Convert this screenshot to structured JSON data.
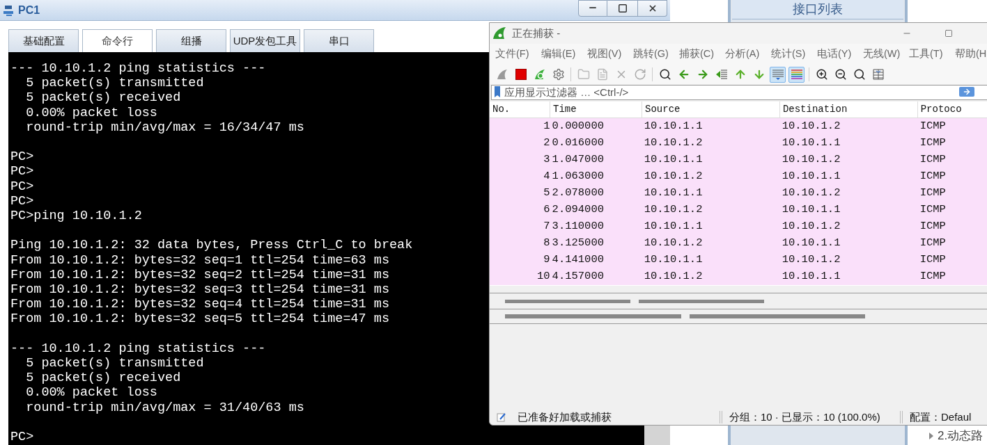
{
  "pc_window": {
    "title": "PC1",
    "tabs": [
      {
        "label": "基础配置",
        "selected": false
      },
      {
        "label": "命令行",
        "selected": true
      },
      {
        "label": "组播",
        "selected": false
      },
      {
        "label": "UDP发包工具",
        "selected": false
      },
      {
        "label": "串口",
        "selected": false
      }
    ],
    "terminal_blocks": [
      [
        "--- 10.10.1.2 ping statistics ---",
        "  5 packet(s) transmitted",
        "  5 packet(s) received",
        "  0.00% packet loss",
        "  round-trip min/avg/max = 16/34/47 ms"
      ],
      [
        "PC>",
        "PC>",
        "PC>",
        "PC>",
        "PC>ping 10.10.1.2"
      ],
      [
        "Ping 10.10.1.2: 32 data bytes, Press Ctrl_C to break",
        "From 10.10.1.2: bytes=32 seq=1 ttl=254 time=63 ms",
        "From 10.10.1.2: bytes=32 seq=2 ttl=254 time=31 ms",
        "From 10.10.1.2: bytes=32 seq=3 ttl=254 time=31 ms",
        "From 10.10.1.2: bytes=32 seq=4 ttl=254 time=31 ms",
        "From 10.10.1.2: bytes=32 seq=5 ttl=254 time=47 ms"
      ],
      [
        "--- 10.10.1.2 ping statistics ---",
        "  5 packet(s) transmitted",
        "  5 packet(s) received",
        "  0.00% packet loss",
        "  round-trip min/avg/max = 31/40/63 ms"
      ],
      [
        "PC>"
      ]
    ]
  },
  "background": {
    "interface_list_button": "接口列表",
    "tree_item": "2.动态路"
  },
  "capture_window": {
    "title": "正在捕获 -",
    "menu": [
      "文件(F)",
      "编辑(E)",
      "视图(V)",
      "跳转(G)",
      "捕获(C)",
      "分析(A)",
      "统计(S)",
      "电话(Y)",
      "无线(W)",
      "工具(T)",
      "帮助(H"
    ],
    "toolbar": [
      {
        "selected": false
      },
      {
        "selected": false
      },
      {
        "selected": false
      },
      {
        "selected": false
      },
      {
        "selected": false
      },
      {
        "selected": false
      },
      {
        "selected": false
      },
      {
        "selected": false
      },
      {
        "selected": false
      },
      {
        "selected": false
      },
      {
        "selected": false
      },
      {
        "selected": false
      },
      {
        "selected": false
      },
      {
        "selected": false
      },
      {
        "selected": true
      },
      {
        "selected": true
      },
      {
        "selected": false
      },
      {
        "selected": false
      },
      {
        "selected": false
      },
      {
        "selected": false
      }
    ],
    "filter": {
      "placeholder": "应用显示过滤器 … <Ctrl-/>"
    },
    "columns": [
      "No.",
      "Time",
      "Source",
      "Destination",
      "Protoco"
    ],
    "rows": [
      [
        "1",
        "0.000000",
        "10.10.1.1",
        "10.10.1.2",
        "ICMP"
      ],
      [
        "2",
        "0.016000",
        "10.10.1.2",
        "10.10.1.1",
        "ICMP"
      ],
      [
        "3",
        "1.047000",
        "10.10.1.1",
        "10.10.1.2",
        "ICMP"
      ],
      [
        "4",
        "1.063000",
        "10.10.1.2",
        "10.10.1.1",
        "ICMP"
      ],
      [
        "5",
        "2.078000",
        "10.10.1.1",
        "10.10.1.2",
        "ICMP"
      ],
      [
        "6",
        "2.094000",
        "10.10.1.2",
        "10.10.1.1",
        "ICMP"
      ],
      [
        "7",
        "3.110000",
        "10.10.1.1",
        "10.10.1.2",
        "ICMP"
      ],
      [
        "8",
        "3.125000",
        "10.10.1.2",
        "10.10.1.1",
        "ICMP"
      ],
      [
        "9",
        "4.141000",
        "10.10.1.1",
        "10.10.1.2",
        "ICMP"
      ],
      [
        "10",
        "4.157000",
        "10.10.1.2",
        "10.10.1.1",
        "ICMP"
      ]
    ],
    "status_bar": {
      "message": "已准备好加载或捕获",
      "packets": "分组：10 · 已显示：10 (100.0%)",
      "profile": "配置：Defaul"
    }
  }
}
